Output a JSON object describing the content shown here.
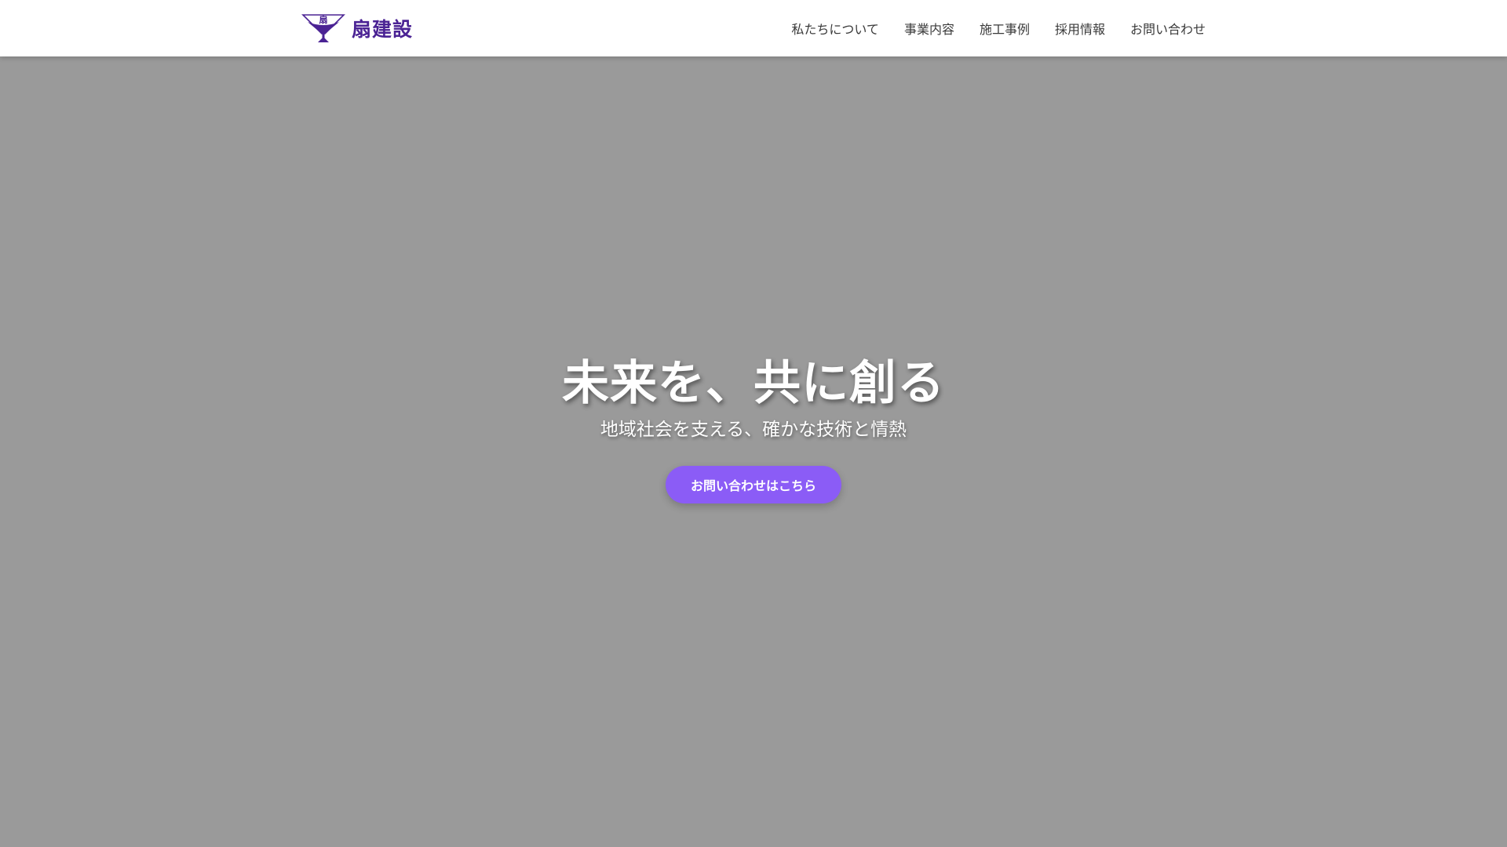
{
  "header": {
    "logo": {
      "mark_text": "扇",
      "name": "扇建設",
      "icon": "folding-fan-logo-icon",
      "color": "#4b2394"
    },
    "nav": [
      {
        "label": "私たちについて"
      },
      {
        "label": "事業内容"
      },
      {
        "label": "施工事例"
      },
      {
        "label": "採用情報"
      },
      {
        "label": "お問い合わせ"
      }
    ]
  },
  "hero": {
    "title": "未来を、共に創る",
    "subtitle": "地域社会を支える、確かな技術と情熱",
    "cta_label": "お問い合わせはこちら",
    "background_color": "#9a9a9a",
    "cta_color": "#8b5cf6"
  }
}
